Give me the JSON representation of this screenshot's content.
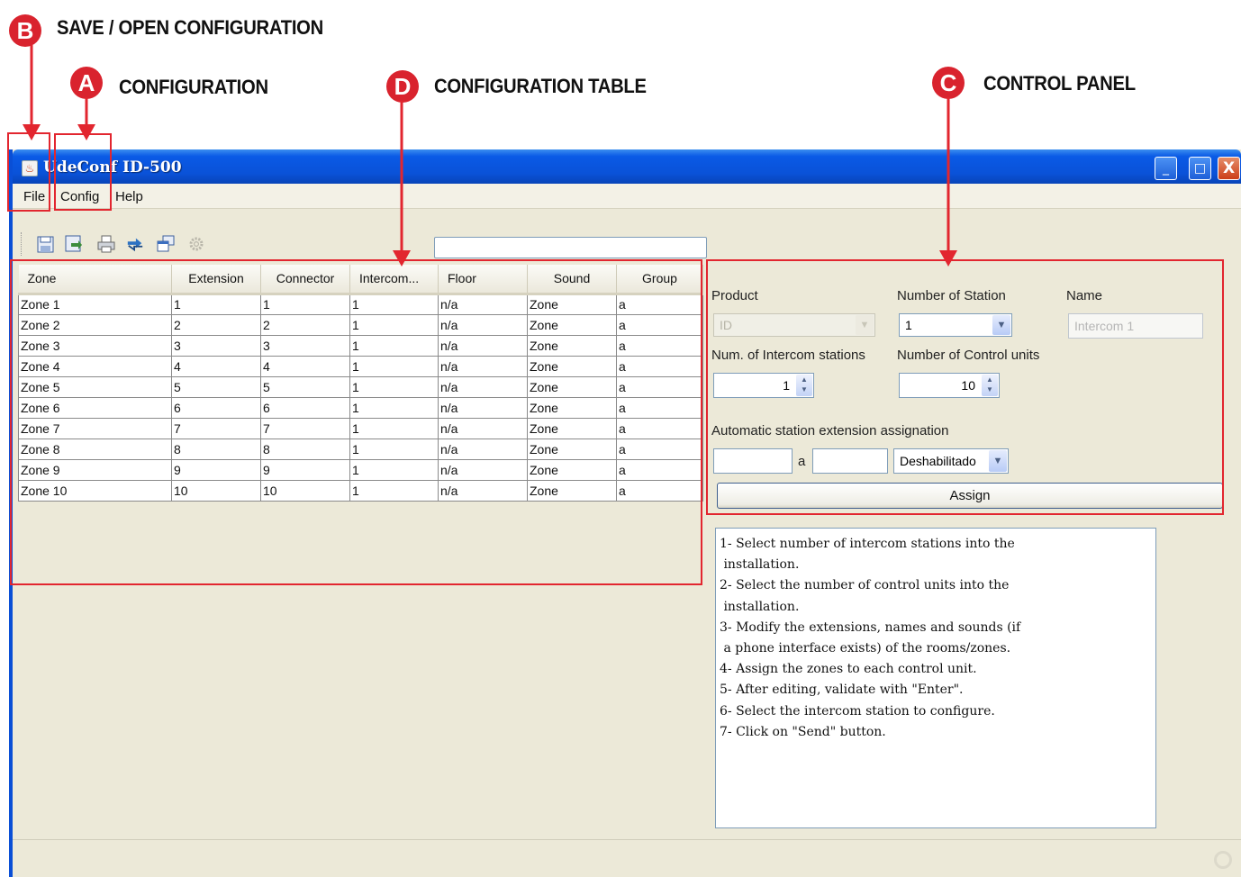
{
  "callouts": {
    "b": {
      "letter": "B",
      "label": "SAVE / OPEN CONFIGURATION"
    },
    "a": {
      "letter": "A",
      "label": "CONFIGURATION"
    },
    "d": {
      "letter": "D",
      "label": "CONFIGURATION TABLE"
    },
    "c": {
      "letter": "C",
      "label": "CONTROL PANEL"
    }
  },
  "colors": {
    "accent": "#d9232e",
    "titlebar": "#0a52d8",
    "window_bg": "#ece9d8"
  },
  "window": {
    "title": "UdeConf ID-500",
    "minimize_label": "_",
    "maximize_label": "□",
    "close_label": "X"
  },
  "menu": {
    "file": "File",
    "config": "Config",
    "help": "Help"
  },
  "toolbar": {
    "icons": [
      "save-icon",
      "open-icon",
      "print-icon",
      "transfer-icon",
      "copy-window-icon",
      "gear-icon"
    ]
  },
  "status_field": {
    "value": ""
  },
  "table": {
    "headers": [
      "Zone",
      "Extension",
      "Connector",
      "Intercom...",
      "Floor",
      "Sound",
      "Group"
    ],
    "rows": [
      [
        "Zone 1",
        "1",
        "1",
        "1",
        "n/a",
        "Zone",
        "a"
      ],
      [
        "Zone 2",
        "2",
        "2",
        "1",
        "n/a",
        "Zone",
        "a"
      ],
      [
        "Zone 3",
        "3",
        "3",
        "1",
        "n/a",
        "Zone",
        "a"
      ],
      [
        "Zone 4",
        "4",
        "4",
        "1",
        "n/a",
        "Zone",
        "a"
      ],
      [
        "Zone 5",
        "5",
        "5",
        "1",
        "n/a",
        "Zone",
        "a"
      ],
      [
        "Zone 6",
        "6",
        "6",
        "1",
        "n/a",
        "Zone",
        "a"
      ],
      [
        "Zone 7",
        "7",
        "7",
        "1",
        "n/a",
        "Zone",
        "a"
      ],
      [
        "Zone 8",
        "8",
        "8",
        "1",
        "n/a",
        "Zone",
        "a"
      ],
      [
        "Zone 9",
        "9",
        "9",
        "1",
        "n/a",
        "Zone",
        "a"
      ],
      [
        "Zone 10",
        "10",
        "10",
        "1",
        "n/a",
        "Zone",
        "a"
      ]
    ]
  },
  "panel": {
    "product_label": "Product",
    "product_value": "ID",
    "num_station_label": "Number of Station",
    "num_station_value": "1",
    "name_label": "Name",
    "name_value": "Intercom 1",
    "intercom_label": "Num. of Intercom stations",
    "intercom_value": "1",
    "control_units_label": "Number of Control units",
    "control_units_value": "10",
    "auto_label": "Automatic station extension assignation",
    "range_from": "",
    "range_sep": "a",
    "range_to": "",
    "mode_value": "Deshabilitado",
    "assign_label": "Assign"
  },
  "help_lines": [
    "1- Select number of intercom stations into the",
    " installation.",
    "2- Select the number of control units into the",
    " installation.",
    "3- Modify the extensions, names and sounds (if",
    " a phone interface exists) of the rooms/zones.",
    "4- Assign the zones to each control unit.",
    "5- After editing, validate with \"Enter\".",
    "6- Select the intercom station to configure.",
    "7- Click on \"Send\" button."
  ]
}
